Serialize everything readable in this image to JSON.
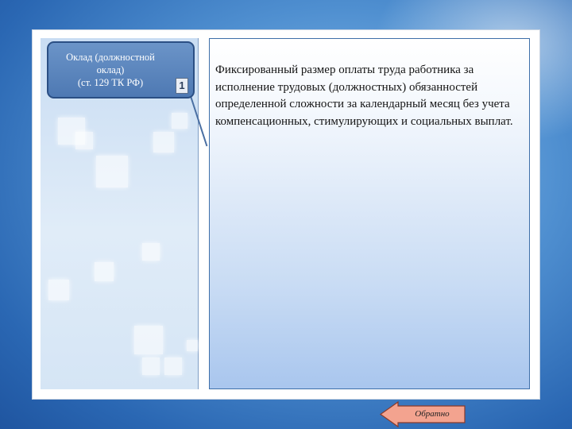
{
  "term": {
    "line1": "Оклад (должностной",
    "line2": "оклад)",
    "line3": "(ст. 129 ТК РФ)"
  },
  "info_icon": {
    "glyph": "1",
    "icon": "info-icon"
  },
  "definition": {
    "text": "Фиксированный размер оплаты труда работника за исполнение трудовых (должностных) обязанностей определенной сложности за календарный месяц без учета компенсационных, стимулирующих и социальных выплат."
  },
  "navigation": {
    "back_label": "Обратно"
  },
  "colors": {
    "term_box": "#4e79b3",
    "back_arrow": "#f3a38f",
    "panel_border": "#3e6fa9"
  }
}
